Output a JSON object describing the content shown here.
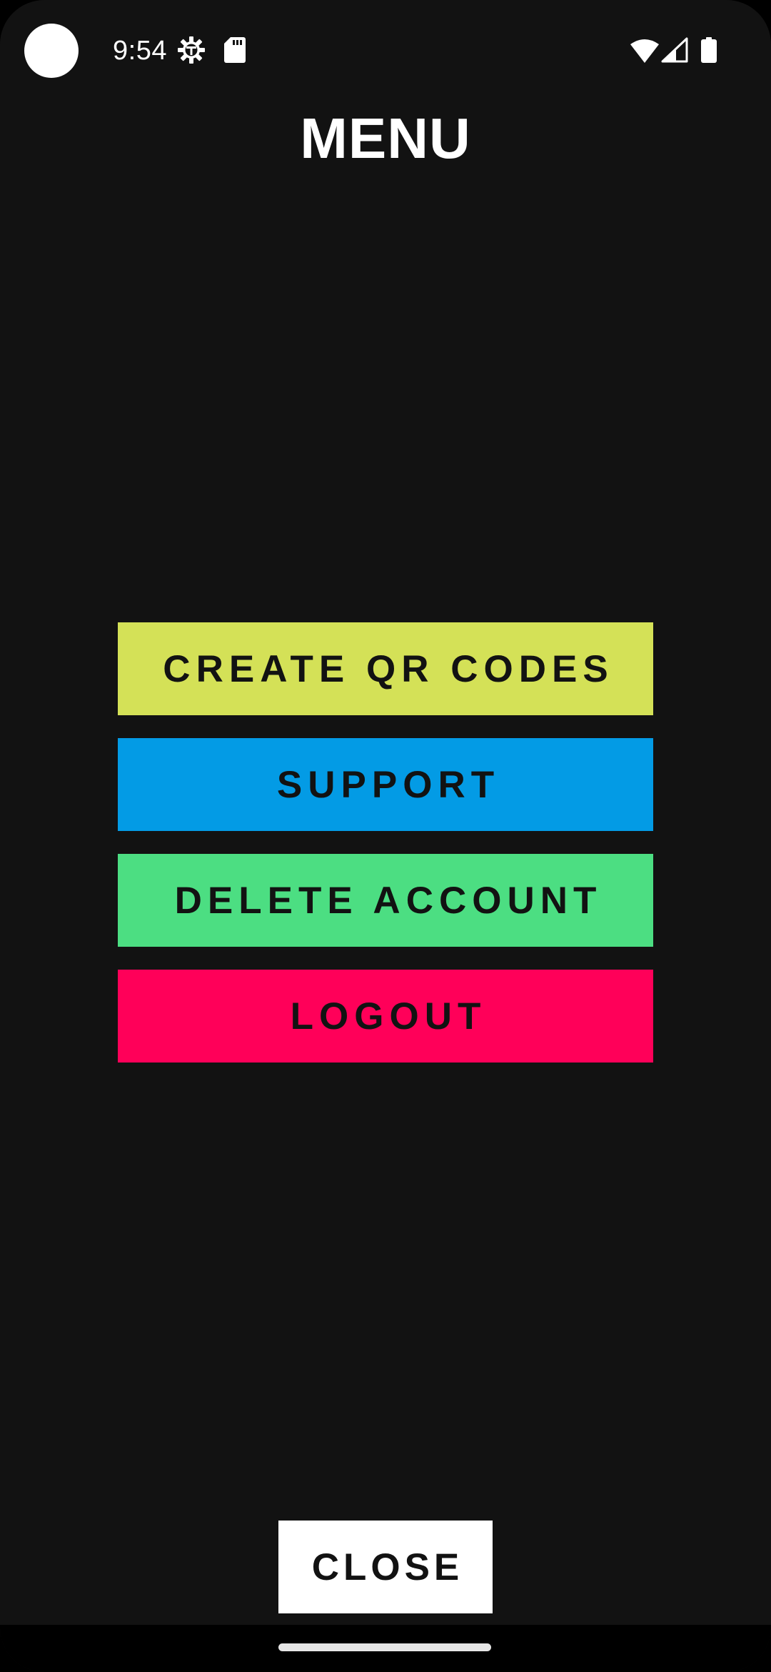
{
  "status_bar": {
    "time": "9:54",
    "icons": [
      "gear-icon",
      "sd-card-icon",
      "wifi-icon",
      "cell-signal-icon",
      "battery-icon"
    ]
  },
  "page": {
    "title": "MENU"
  },
  "menu": {
    "buttons": [
      {
        "label": "CREATE QR CODES",
        "color": "#d4e157"
      },
      {
        "label": "SUPPORT",
        "color": "#039be5"
      },
      {
        "label": "DELETE ACCOUNT",
        "color": "#4cde82"
      },
      {
        "label": "LOGOUT",
        "color": "#ff0059"
      }
    ]
  },
  "footer": {
    "close_label": "CLOSE"
  },
  "theme": {
    "background": "#121212",
    "text_dark": "#121212",
    "text_light": "#ffffff"
  }
}
